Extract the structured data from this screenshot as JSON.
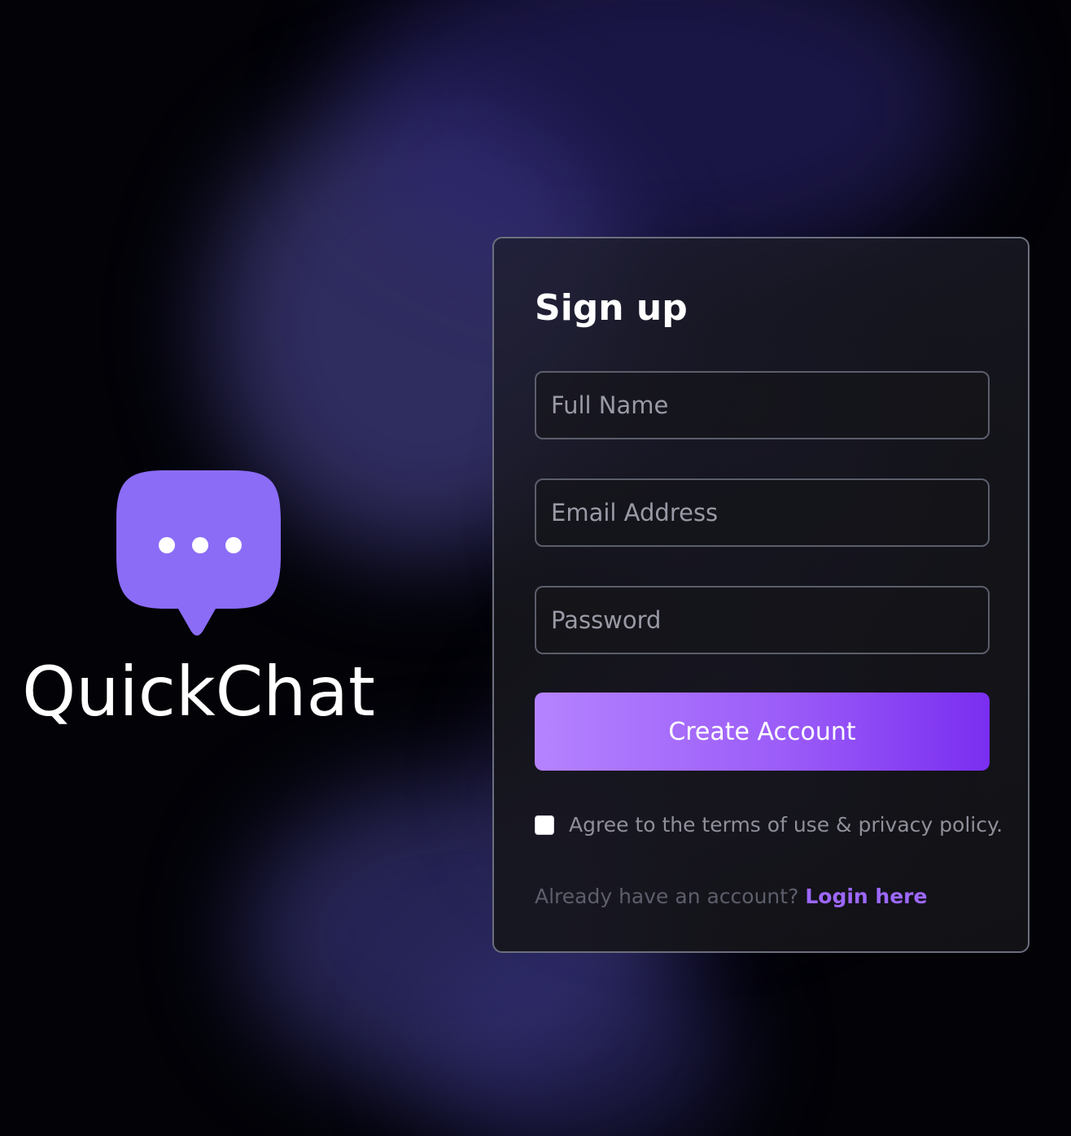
{
  "brand": {
    "name": "QuickChat",
    "logo_icon": "chat-bubble-dots-icon",
    "logo_color": "#8b6cf6"
  },
  "signup": {
    "title": "Sign up",
    "full_name_placeholder": "Full Name",
    "email_placeholder": "Email Address",
    "password_placeholder": "Password",
    "submit_label": "Create Account",
    "terms_label": "Agree to the terms of use & privacy policy.",
    "terms_checked": false,
    "login_prompt": "Already have an account?",
    "login_link": "Login here"
  },
  "colors": {
    "accent": "#8b5cf6",
    "button_gradient_start": "#b583ff",
    "button_gradient_end": "#7a2ef0",
    "link": "#9d68ff",
    "background": "#020207"
  }
}
